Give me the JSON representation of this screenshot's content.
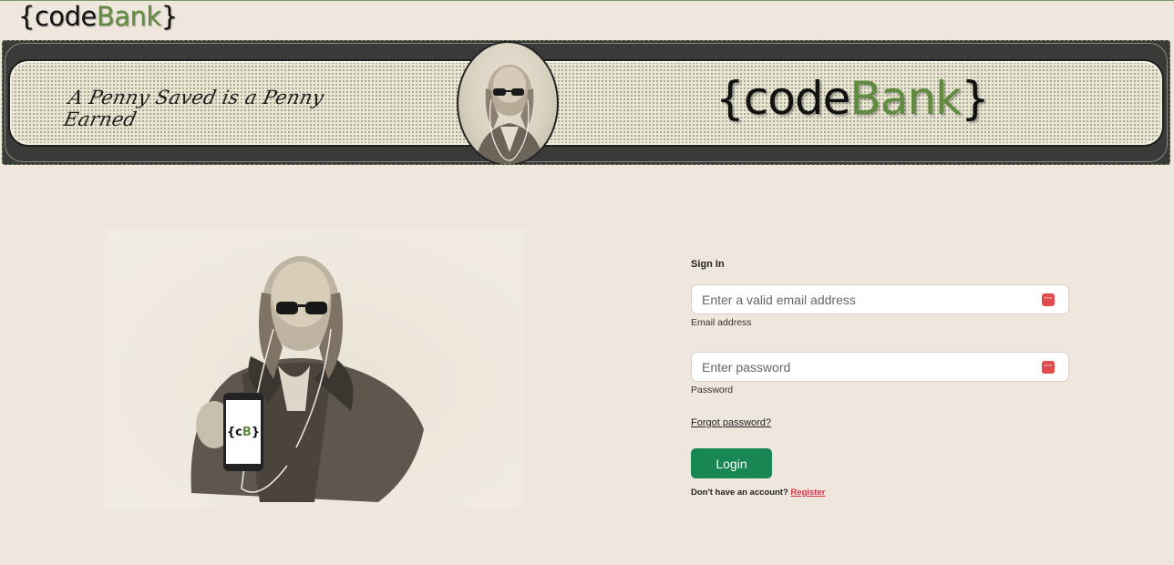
{
  "header": {
    "logo_prefix": "{code",
    "logo_accent": "Bank",
    "logo_suffix": "}"
  },
  "banner": {
    "motto": "A Penny Saved is a Penny Earned",
    "logo_prefix": "{code",
    "logo_accent": "Bank",
    "logo_suffix": "}"
  },
  "hero": {
    "phone_prefix": "{c",
    "phone_accent": "B",
    "phone_suffix": "}"
  },
  "form": {
    "title": "Sign In",
    "email": {
      "placeholder": "Enter a valid email address",
      "label": "Email address",
      "value": ""
    },
    "password": {
      "placeholder": "Enter password",
      "label": "Password",
      "value": ""
    },
    "forgot_link": "Forgot password?",
    "login_label": "Login",
    "register_prompt": "Don't have an account? ",
    "register_link": "Register"
  },
  "colors": {
    "background": "#efe6dd",
    "accent_green": "#5f8c3f",
    "button_green": "#198754",
    "register_red": "#d9364a"
  },
  "icons": {
    "password_manager": "password-manager-icon"
  }
}
